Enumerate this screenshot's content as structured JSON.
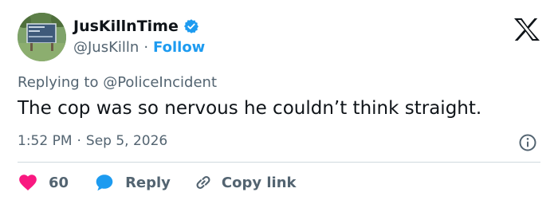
{
  "user": {
    "display_name": "JusKillnTime",
    "handle": "@JusKilln",
    "separator": "·",
    "follow_label": "Follow",
    "verified": true
  },
  "platform": {
    "logo": "x-logo-icon"
  },
  "reply_context": {
    "prefix": "Replying to",
    "mention": "@PoliceIncident"
  },
  "tweet": {
    "text": "The cop was so nervous he couldn’t think straight."
  },
  "meta": {
    "time": "1:52 PM",
    "separator": "·",
    "date": "Sep 5, 2026",
    "info_icon": "info-icon"
  },
  "actions": {
    "like_count": "60",
    "reply_label": "Reply",
    "copy_link_label": "Copy link"
  },
  "colors": {
    "accent": "#1d9bf0",
    "like": "#f91880",
    "text": "#0f1419",
    "muted": "#536471",
    "divider": "#cfd9de"
  }
}
